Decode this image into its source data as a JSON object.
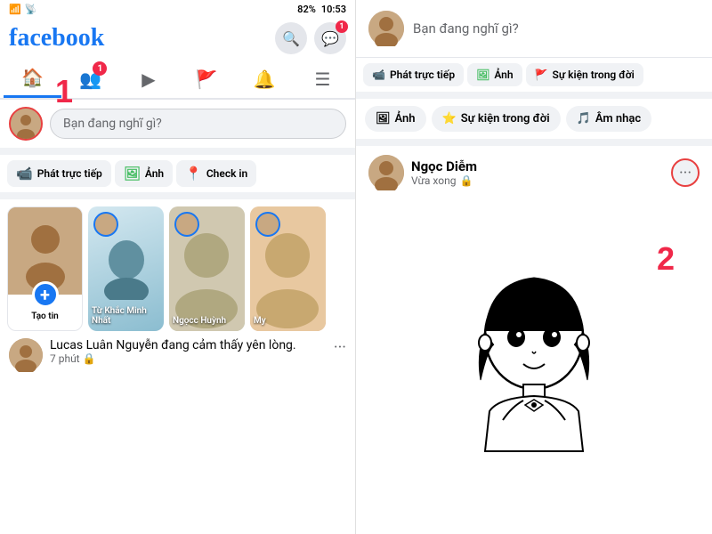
{
  "left": {
    "status_bar": {
      "signal": "📶",
      "wifi": "📡",
      "battery": "82%",
      "time": "10:53"
    },
    "logo": "facebook",
    "nav": {
      "tabs": [
        "🏠",
        "👥",
        "▶",
        "🚩",
        "🔔",
        "☰"
      ],
      "active": 0,
      "badge_tab": 1,
      "badge_val": "1"
    },
    "post_box": {
      "placeholder": "Bạn đang nghĩ gì?"
    },
    "quick_actions": [
      {
        "icon": "📹",
        "label": "Phát trực tiếp",
        "color": "#f02849"
      },
      {
        "icon": "🖼",
        "label": "Ảnh",
        "color": "#45bd62"
      },
      {
        "icon": "📍",
        "label": "Check in",
        "color": "#f7b928"
      }
    ],
    "stories": [
      {
        "type": "create",
        "label": "Tạo tin"
      },
      {
        "type": "person",
        "name": "Từ Khắc Minh Nhất"
      },
      {
        "type": "person",
        "name": "Ngọcc Huỳnh"
      },
      {
        "type": "person",
        "name": "My"
      }
    ],
    "post": {
      "name": "Lucas Luân Nguyễn",
      "action": "đang",
      "feeling": "cảm thấy yên lòng.",
      "time": "7 phút",
      "privacy": "🔒"
    }
  },
  "right": {
    "post_box": {
      "placeholder": "Bạn đang nghĩ gì?"
    },
    "quick_actions": [
      {
        "icon": "📹",
        "label": "Phát trực tiếp",
        "color": "#f02849"
      },
      {
        "icon": "🖼",
        "label": "Ảnh",
        "color": "#45bd62"
      },
      {
        "icon": "🚩",
        "label": "Sự kiện trong đời",
        "color": "#1877f2"
      }
    ],
    "second_row": [
      {
        "icon": "🖼",
        "label": "Ảnh"
      },
      {
        "icon": "⭐",
        "label": "Sự kiện trong đời"
      },
      {
        "icon": "🎵",
        "label": "Âm nhạc"
      }
    ],
    "post": {
      "name": "Ngọc Diễm",
      "meta": "Vừa xong",
      "privacy": "🔒"
    }
  },
  "markers": {
    "num1": "1",
    "num2": "2"
  }
}
